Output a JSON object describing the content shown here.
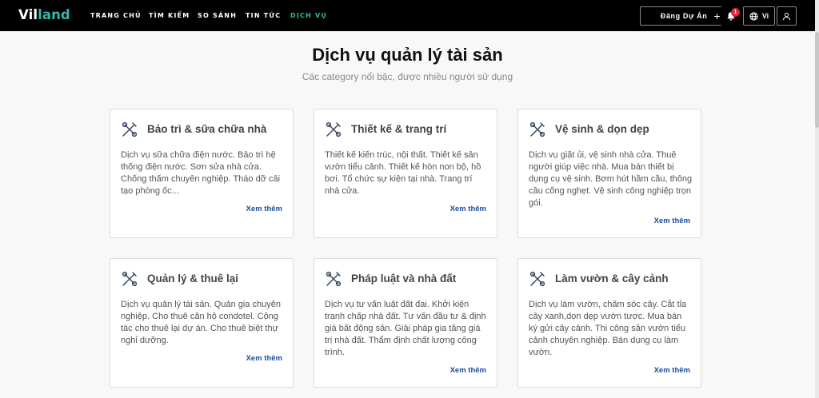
{
  "header": {
    "logo": {
      "part1": "Vil",
      "part2": "land"
    },
    "nav": [
      {
        "label": "TRANG CHỦ",
        "active": false
      },
      {
        "label": "TÌM KIẾM",
        "active": false
      },
      {
        "label": "SO SÁNH",
        "active": false
      },
      {
        "label": "TIN TỨC",
        "active": false
      },
      {
        "label": "DỊCH VỤ",
        "active": true
      }
    ],
    "post_button": {
      "label": "Đăng Dự Án",
      "icon": "plus-icon"
    },
    "notifications": {
      "icon": "bell-icon",
      "count": "1"
    },
    "language": {
      "label": "Vi",
      "icon": "globe-icon"
    },
    "user": {
      "icon": "user-icon"
    },
    "colors": {
      "accent": "#2fb9a8",
      "badge": "#e0243a",
      "link": "#1a4d9c"
    }
  },
  "main": {
    "title": "Dịch vụ quản lý tài sản",
    "subtitle": "Các category nổi bậc, được nhiều người sử dụng",
    "cards": [
      {
        "icon": "tools-icon",
        "title": "Bảo trì & sữa chữa nhà",
        "description": "Dịch vụ sữa chữa điện nước. Bảo trì hệ thống điện nước. Sơn sửa nhà cửa. Chống thấm chuyên nghiệp. Tháo dỡ cải tạo phòng ốc...",
        "link": "Xem thêm"
      },
      {
        "icon": "tools-icon",
        "title": "Thiết kế & trang trí",
        "description": "Thiết kế kiến trúc, nội thất. Thiết kế sân vườn tiểu cảnh. Thiết kế hòn non bộ, hồ bơi. Tổ chức sự kiện tại nhà. Trang trí nhà cửa.",
        "link": "Xem thêm"
      },
      {
        "icon": "tools-icon",
        "title": "Vệ sinh & dọn dẹp",
        "description": "Dịch vụ giặt ủi, vệ sinh nhà cửa. Thuê người giúp việc nhà. Mua bán thiết bị dụng cụ vệ sinh. Bơm hút hầm cầu, thông cầu cống nghẹt. Vệ sinh công nghiệp trọn gói.",
        "link": "Xem thêm"
      },
      {
        "icon": "tools-icon",
        "title": "Quản lý & thuê lại",
        "description": "Dịch vụ quản lý tài sản. Quản gia chuyên nghiệp. Cho thuê căn hộ condotel. Cộng tác cho thuê lại dự án. Cho thuê biệt thự nghỉ dưỡng.",
        "link": "Xem thêm"
      },
      {
        "icon": "tools-icon",
        "title": "Pháp luật và nhà đất",
        "description": "Dịch vụ tư vấn luật đất đai. Khởi kiện tranh chấp nhà đất. Tư vấn đầu tư & định giá bất động sản. Giải pháp gia tăng giá trị nhà đất. Thẩm định chất lượng công trình.",
        "link": "Xem thêm"
      },
      {
        "icon": "tools-icon",
        "title": "Làm vườn & cây cảnh",
        "description": "Dịch vụ làm vườn, chăm sóc cây. Cắt tỉa cây xanh,dọn dẹp vườn tược. Mua bán ký gửi cây cảnh. Thi công sân vườn tiểu cảnh chuyên nghiệp. Bán dụng cụ làm vườn.",
        "link": "Xem thêm"
      }
    ]
  }
}
